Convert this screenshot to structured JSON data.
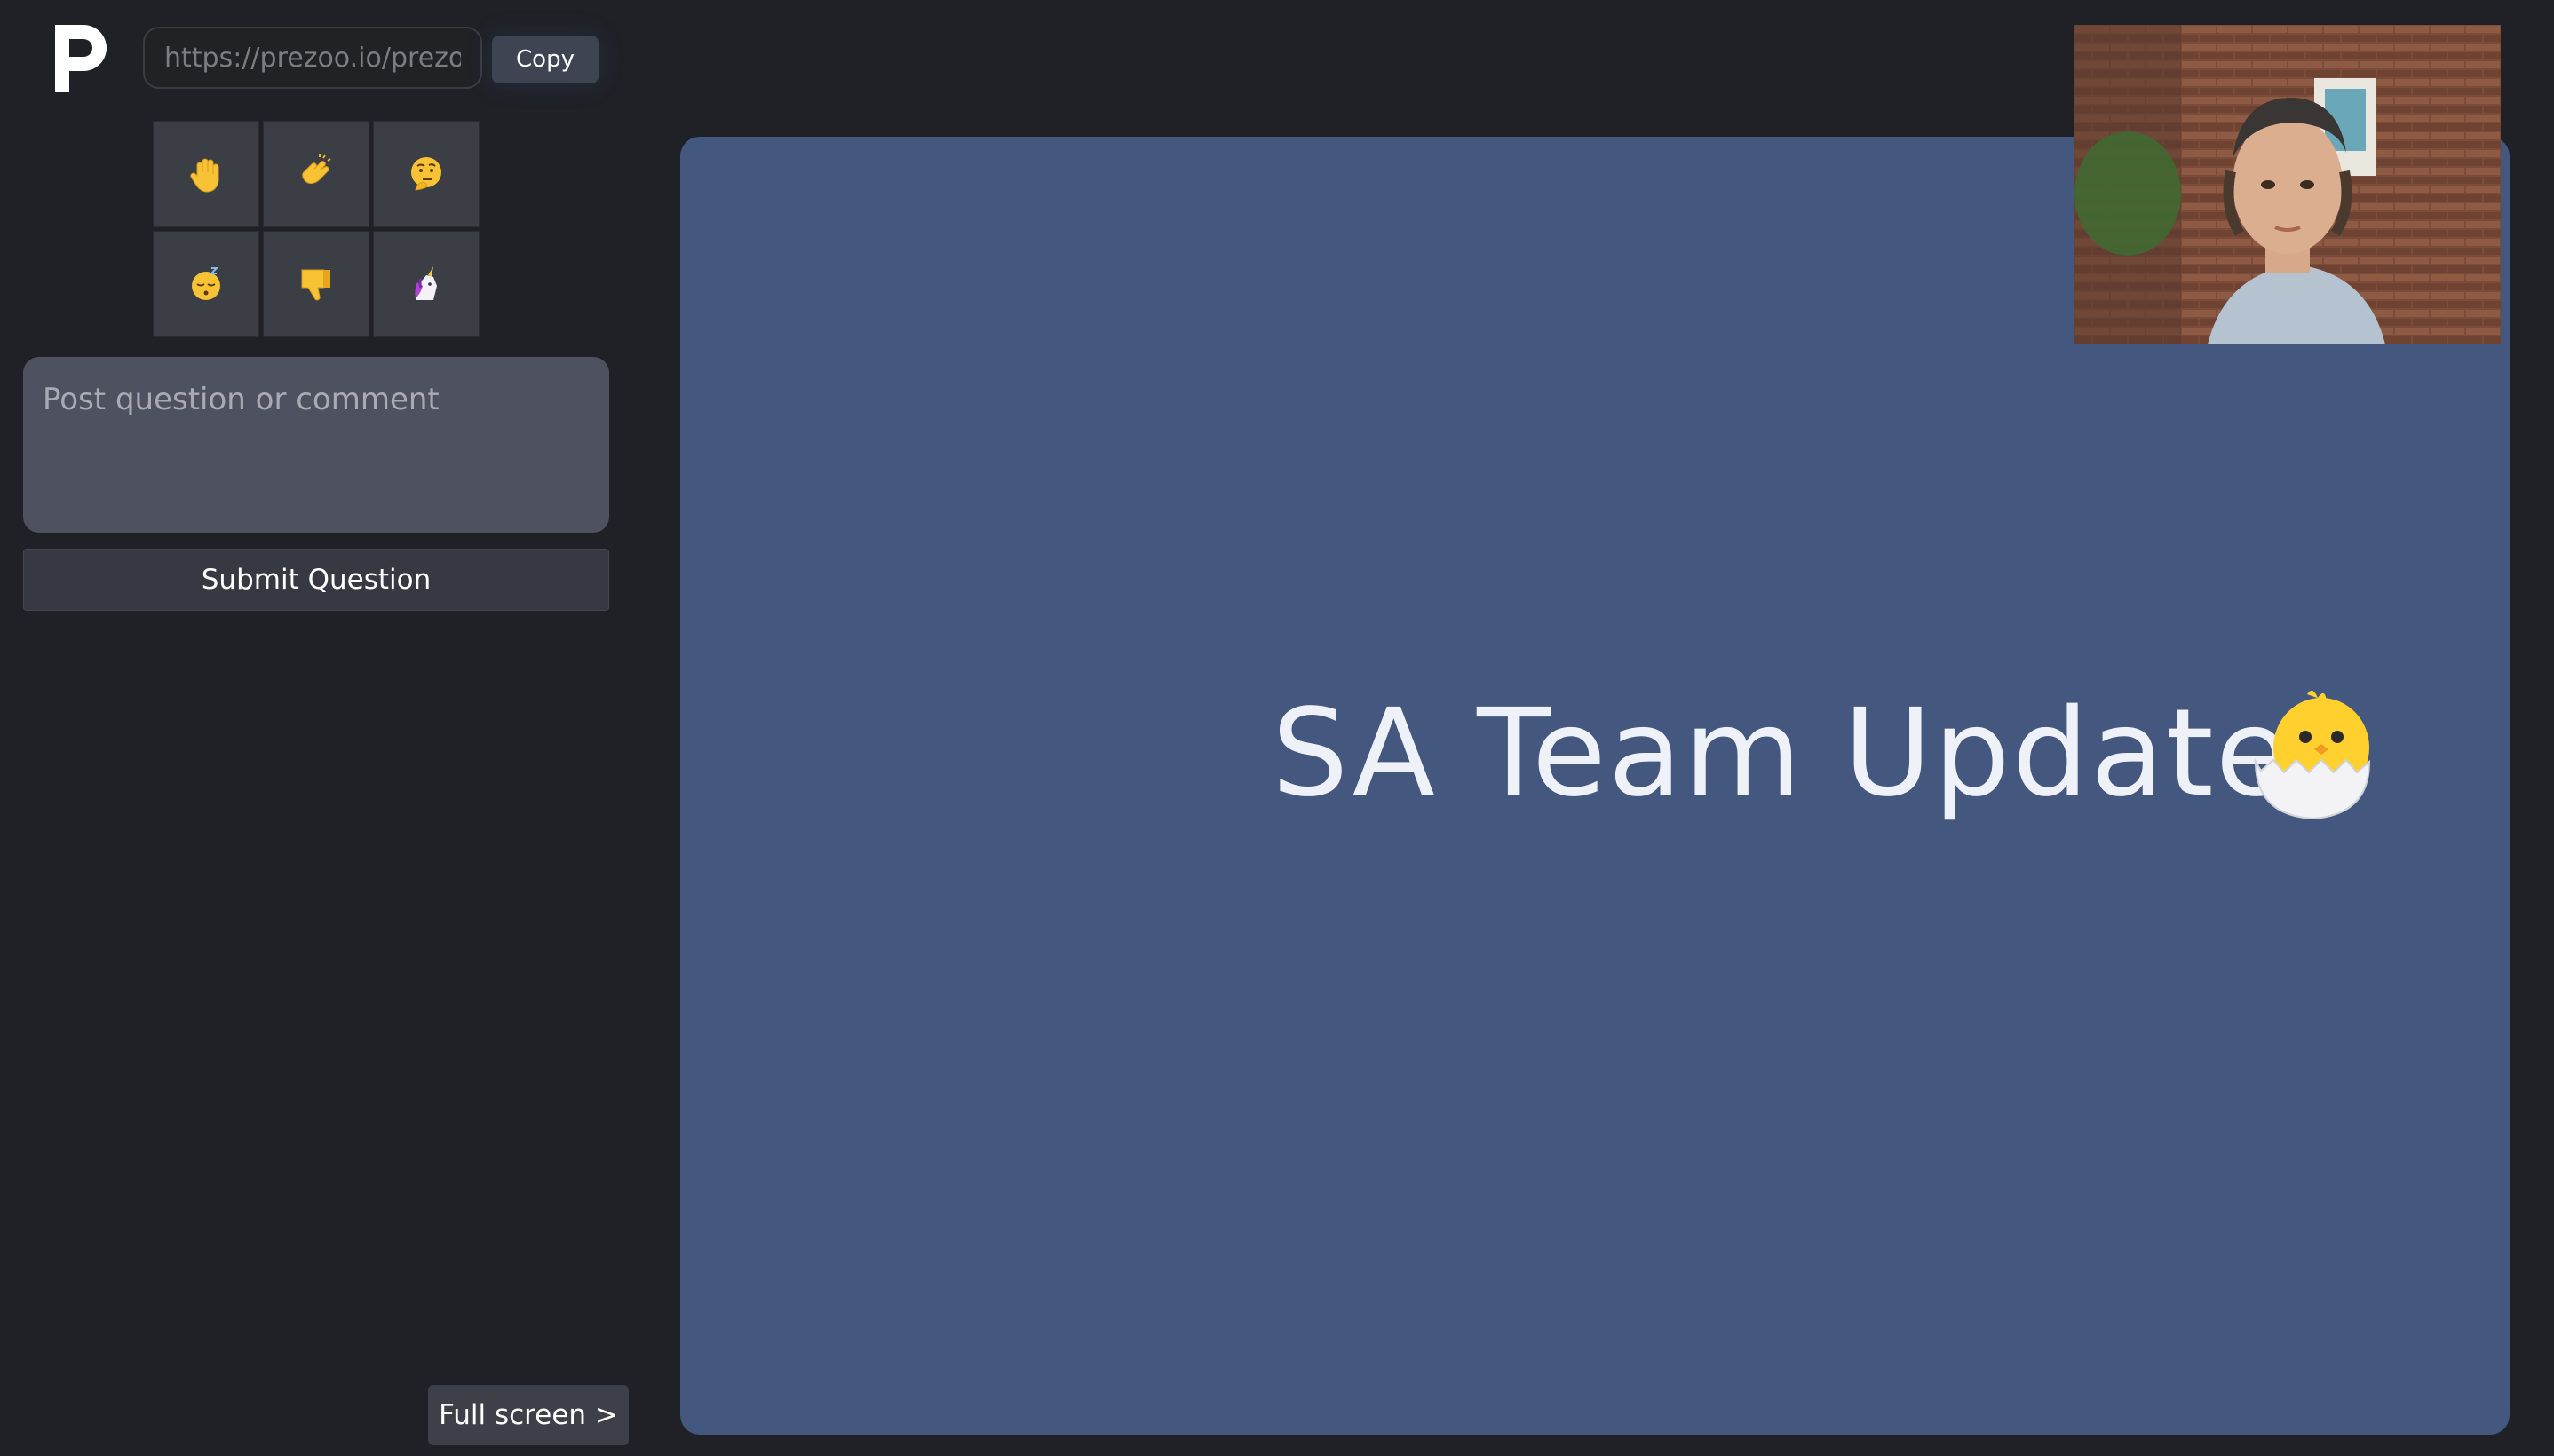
{
  "app": {
    "logo_letter": "p"
  },
  "header": {
    "share_url": "https://prezoo.io/prezoo",
    "copy_label": "Copy"
  },
  "reactions": [
    {
      "name": "raised-hand-icon"
    },
    {
      "name": "clapping-hands-icon"
    },
    {
      "name": "thinking-face-icon"
    },
    {
      "name": "sleeping-face-icon"
    },
    {
      "name": "thumbs-down-icon"
    },
    {
      "name": "unicorn-icon"
    }
  ],
  "question": {
    "placeholder": "Post question or comment",
    "submit_label": "Submit Question"
  },
  "footer": {
    "fullscreen_label": "Full screen >"
  },
  "slide": {
    "title": "SA Team Update",
    "emoji": "hatching-chick-icon",
    "background": "#44577e"
  },
  "colors": {
    "page_background": "#1f2126",
    "panel_button": "#3b3e45",
    "text_primary": "#ffffff"
  }
}
